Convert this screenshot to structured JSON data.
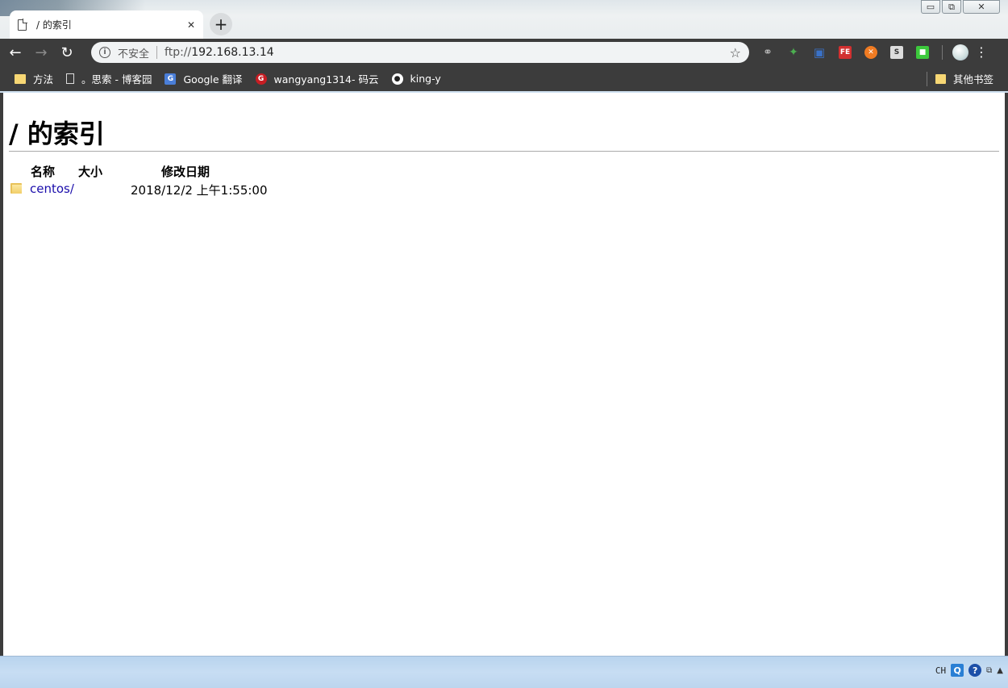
{
  "window": {
    "minimize": "▭",
    "maximize": "⧉",
    "close": "✕"
  },
  "tab": {
    "title": "/ 的索引",
    "close": "✕",
    "new_tab": "+"
  },
  "toolbar": {
    "back": "←",
    "forward": "→",
    "reload": "↻",
    "security_label": "不安全",
    "url_scheme": "ftp://",
    "url_host": "192.168.13.14",
    "star": "☆"
  },
  "extensions": [
    {
      "icon": "link-extension-icon",
      "glyph": "⚭",
      "color": "#bbbbbb"
    },
    {
      "icon": "puzzle-extension-icon",
      "glyph": "✦",
      "color": "#4caf50"
    },
    {
      "icon": "save-extension-icon",
      "glyph": "▣",
      "color": "#3a72c8"
    },
    {
      "icon": "fe-extension-icon",
      "glyph": "FE",
      "color": "#d23030"
    },
    {
      "icon": "orange-extension-icon",
      "glyph": "✕",
      "color": "#f07b22"
    },
    {
      "icon": "s-extension-icon",
      "glyph": "S",
      "color": "#cccccc"
    },
    {
      "icon": "green-square-extension-icon",
      "glyph": "■",
      "color": "#3cc93c"
    }
  ],
  "bookmarks": [
    {
      "label": "方法",
      "icon": "folder-icon"
    },
    {
      "label": "。思索 - 博客园",
      "icon": "page-icon"
    },
    {
      "label": "Google 翻译",
      "icon": "google-translate-icon"
    },
    {
      "label": "wangyang1314- 码云",
      "icon": "gitee-icon"
    },
    {
      "label": "king-y",
      "icon": "github-icon"
    }
  ],
  "other_bookmarks": "其他书签",
  "page": {
    "heading": "/ 的索引",
    "columns": {
      "name": "名称",
      "size": "大小",
      "modified": "修改日期"
    },
    "entries": [
      {
        "name": "centos/",
        "size": "",
        "modified": "2018/12/2 上午1:55:00"
      }
    ]
  },
  "taskbar": {
    "lang": "CH",
    "q": "Q",
    "help": "?",
    "expand": "▲"
  }
}
